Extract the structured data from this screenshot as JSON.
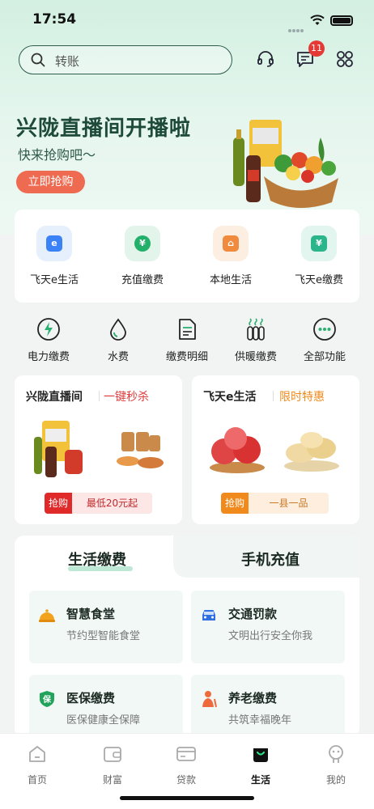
{
  "status_bar": {
    "time": "17:54"
  },
  "header": {
    "search_placeholder": "转账",
    "message_badge": "11",
    "icons": [
      "search-icon",
      "headset-icon",
      "message-icon",
      "apps-grid-icon"
    ]
  },
  "banner": {
    "title": "兴陇直播间开播啦",
    "subtitle": "快来抢购吧～",
    "button": "立即抢购"
  },
  "services": [
    {
      "label": "飞天e生活",
      "icon": "e-life-icon",
      "color": "#3b82f6"
    },
    {
      "label": "充值缴费",
      "icon": "recharge-icon",
      "color": "#22b06a"
    },
    {
      "label": "本地生活",
      "icon": "local-life-icon",
      "color": "#f08a3c"
    },
    {
      "label": "飞天e缴费",
      "icon": "e-pay-icon",
      "color": "#2bb58a"
    }
  ],
  "utilities": [
    {
      "label": "电力缴费",
      "icon": "electricity-icon"
    },
    {
      "label": "水费",
      "icon": "water-drop-icon"
    },
    {
      "label": "缴费明细",
      "icon": "bill-detail-icon"
    },
    {
      "label": "供暖缴费",
      "icon": "heating-icon"
    },
    {
      "label": "全部功能",
      "icon": "more-icon"
    }
  ],
  "promos": [
    {
      "title": "兴陇直播间",
      "tag": "一键秒杀",
      "tag_color": "#e03b3b",
      "btn_left": "抢购",
      "btn_right": "最低20元起"
    },
    {
      "title": "飞天e生活",
      "tag": "限时特惠",
      "tag_color": "#f08a1c",
      "btn_left": "抢购",
      "btn_right": "一县一品"
    }
  ],
  "tabs": {
    "active": "生活缴费",
    "inactive": "手机充值"
  },
  "tiles": [
    {
      "title": "智慧食堂",
      "subtitle": "节约型智能食堂",
      "icon": "canteen-icon"
    },
    {
      "title": "交通罚款",
      "subtitle": "文明出行安全你我",
      "icon": "car-icon"
    },
    {
      "title": "医保缴费",
      "subtitle": "医保健康全保障",
      "icon": "medical-insurance-icon"
    },
    {
      "title": "养老缴费",
      "subtitle": "共筑幸福晚年",
      "icon": "elderly-icon"
    }
  ],
  "tabbar": [
    {
      "label": "首页",
      "icon": "home-icon"
    },
    {
      "label": "财富",
      "icon": "wallet-icon"
    },
    {
      "label": "贷款",
      "icon": "card-icon"
    },
    {
      "label": "生活",
      "icon": "bag-icon",
      "active": true
    },
    {
      "label": "我的",
      "icon": "profile-icon"
    }
  ]
}
